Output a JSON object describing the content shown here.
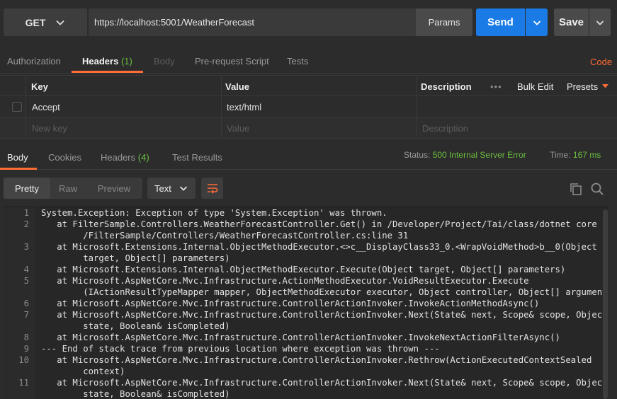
{
  "request": {
    "method": "GET",
    "url": "https://localhost:5001/WeatherForecast",
    "params_label": "Params",
    "send_label": "Send",
    "save_label": "Save"
  },
  "request_tabs": [
    {
      "label": "Authorization"
    },
    {
      "label": "Headers",
      "count": "(1)"
    },
    {
      "label": "Body"
    },
    {
      "label": "Pre-request Script"
    },
    {
      "label": "Tests"
    }
  ],
  "code_label": "Code",
  "headers_table": {
    "columns": [
      "Key",
      "Value",
      "Description"
    ],
    "more_label": "•••",
    "bulk_edit_label": "Bulk Edit",
    "presets_label": "Presets",
    "rows": [
      {
        "key": "Accept",
        "value": "text/html",
        "description": ""
      }
    ],
    "placeholder": {
      "key": "New key",
      "value": "Value",
      "description": "Description"
    }
  },
  "response_tabs": [
    {
      "label": "Body"
    },
    {
      "label": "Cookies"
    },
    {
      "label": "Headers",
      "count": "(4)"
    },
    {
      "label": "Test Results"
    }
  ],
  "status": {
    "status_label": "Status:",
    "status_value": "500 Internal Server Error",
    "time_label": "Time:",
    "time_value": "167 ms"
  },
  "body_toolbar": {
    "views": [
      "Pretty",
      "Raw",
      "Preview"
    ],
    "format": "Text"
  },
  "code_lines": [
    {
      "num": "1",
      "text": [
        "System.Exception: Exception of type 'System.Exception' was thrown."
      ]
    },
    {
      "num": "2",
      "text": [
        "   at FilterSample.Controllers.WeatherForecastController.Get() in /Developer/Project/Tai/class/dotnet core",
        "        /FilterSample/Controllers/WeatherForecastController.cs:line 31"
      ]
    },
    {
      "num": "3",
      "text": [
        "   at Microsoft.Extensions.Internal.ObjectMethodExecutor.<>c__DisplayClass33_0.<WrapVoidMethod>b__0(Object",
        "        target, Object[] parameters)"
      ]
    },
    {
      "num": "4",
      "text": [
        "   at Microsoft.Extensions.Internal.ObjectMethodExecutor.Execute(Object target, Object[] parameters)"
      ]
    },
    {
      "num": "5",
      "text": [
        "   at Microsoft.AspNetCore.Mvc.Infrastructure.ActionMethodExecutor.VoidResultExecutor.Execute",
        "        (IActionResultTypeMapper mapper, ObjectMethodExecutor executor, Object controller, Object[] arguments)"
      ]
    },
    {
      "num": "6",
      "text": [
        "   at Microsoft.AspNetCore.Mvc.Infrastructure.ControllerActionInvoker.InvokeActionMethodAsync()"
      ]
    },
    {
      "num": "7",
      "text": [
        "   at Microsoft.AspNetCore.Mvc.Infrastructure.ControllerActionInvoker.Next(State& next, Scope& scope, Object&",
        "        state, Boolean& isCompleted)"
      ]
    },
    {
      "num": "8",
      "text": [
        "   at Microsoft.AspNetCore.Mvc.Infrastructure.ControllerActionInvoker.InvokeNextActionFilterAsync()"
      ]
    },
    {
      "num": "9",
      "text": [
        "--- End of stack trace from previous location where exception was thrown ---"
      ]
    },
    {
      "num": "10",
      "text": [
        "   at Microsoft.AspNetCore.Mvc.Infrastructure.ControllerActionInvoker.Rethrow(ActionExecutedContextSealed",
        "        context)"
      ]
    },
    {
      "num": "11",
      "text": [
        "   at Microsoft.AspNetCore.Mvc.Infrastructure.ControllerActionInvoker.Next(State& next, Scope& scope, Object&",
        "        state, Boolean& isCompleted)"
      ]
    }
  ],
  "colors": {
    "accent": "#ff6c37",
    "send": "#1a7ae6",
    "status_ok": "#6bbf3e",
    "background": "#2c2c2c"
  }
}
